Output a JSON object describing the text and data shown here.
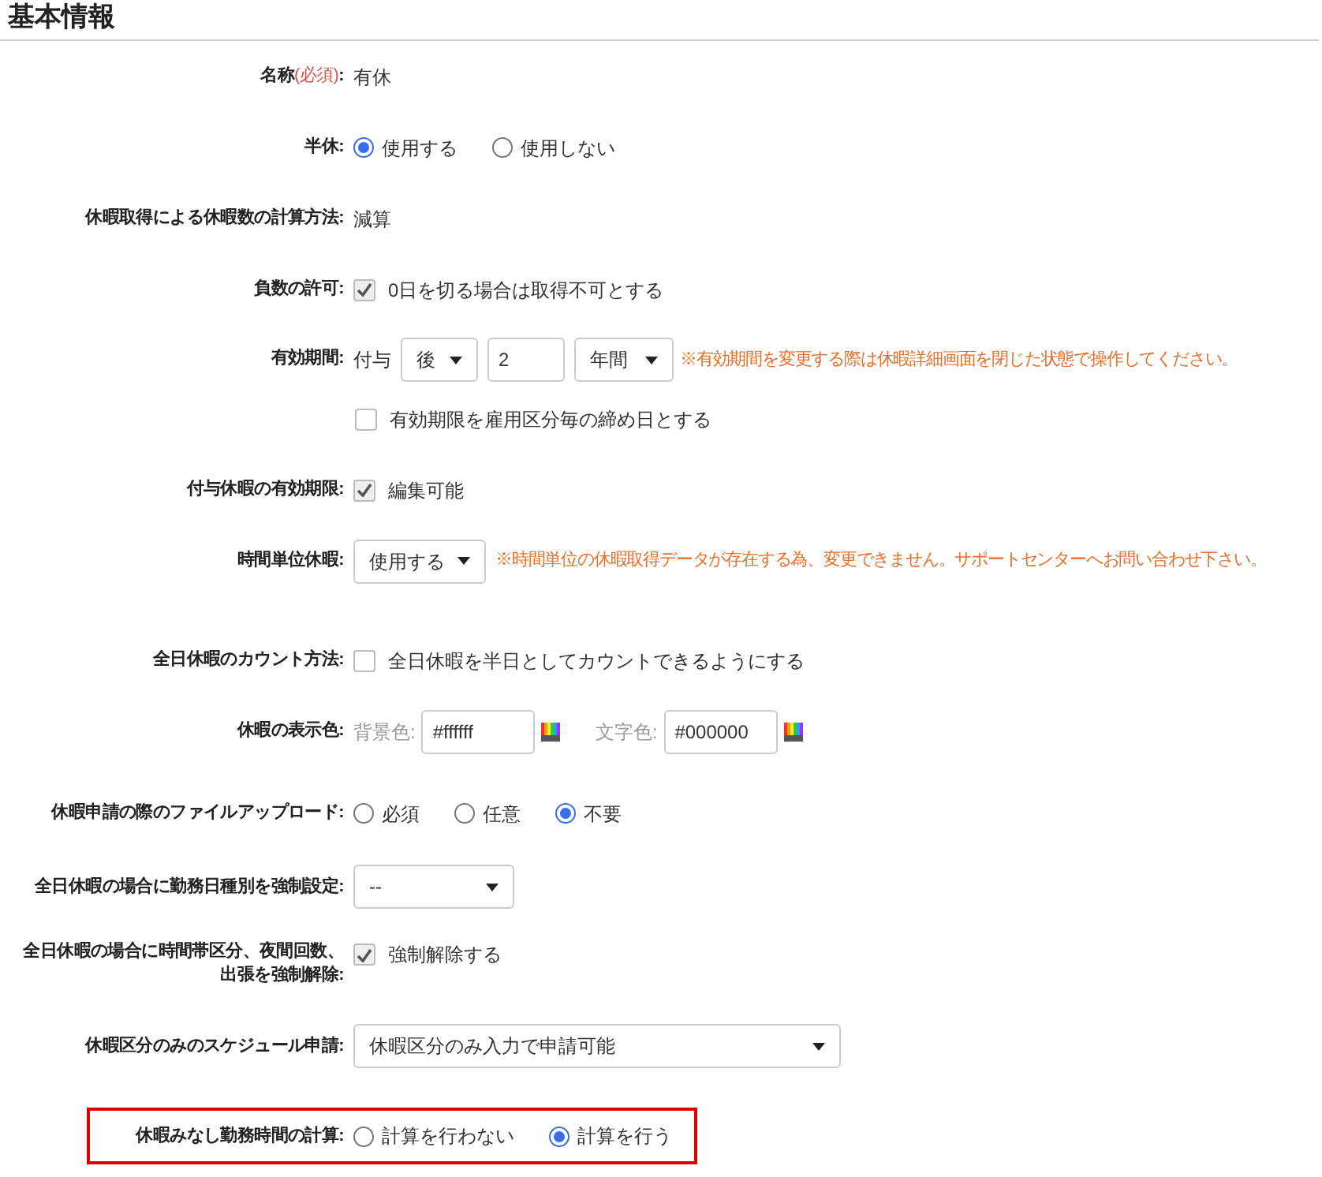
{
  "title": "基本情報",
  "rows": [
    {
      "kind": "text",
      "label": "名称",
      "required": "(必須)",
      "label_end": ":",
      "value": "有休"
    },
    {
      "kind": "radio",
      "label": "半休:",
      "options": [
        {
          "label": "使用する",
          "selected": true
        },
        {
          "label": "使用しない",
          "selected": false
        }
      ]
    },
    {
      "kind": "text",
      "label": "休暇取得による休暇数の計算方法:",
      "value": "減算"
    },
    {
      "kind": "checkbox",
      "label": "負数の許可:",
      "checked": true,
      "text": "0日を切る場合は取得不可とする"
    },
    {
      "kind": "period",
      "label": "有効期間:",
      "prefix": "付与",
      "direction": "後",
      "amount": "2",
      "unit": "年間",
      "note": "※有効期間を変更する際は休暇詳細画面を閉じた状態で操作してください。",
      "sub_checked": false,
      "sub_text": "有効期限を雇用区分毎の締め日とする"
    },
    {
      "kind": "checkbox",
      "label": "付与休暇の有効期限:",
      "checked": true,
      "text": "編集可能"
    },
    {
      "kind": "select",
      "label": "時間単位休暇:",
      "value": "使用する",
      "note": "※時間単位の休暇取得データが存在する為、変更できません。サポートセンターへお問い合わせ下さい。"
    },
    {
      "kind": "checkbox",
      "label": "全日休暇のカウント方法:",
      "checked": false,
      "text": "全日休暇を半日としてカウントできるようにする"
    },
    {
      "kind": "colors",
      "label": "休暇の表示色:",
      "fields": [
        {
          "caption": "背景色:",
          "value": "#ffffff"
        },
        {
          "caption": "文字色:",
          "value": "#000000"
        }
      ]
    },
    {
      "kind": "radio",
      "label": "休暇申請の際のファイルアップロード:",
      "options": [
        {
          "label": "必須",
          "selected": false
        },
        {
          "label": "任意",
          "selected": false
        },
        {
          "label": "不要",
          "selected": true
        }
      ]
    },
    {
      "kind": "select",
      "label": "全日休暇の場合に勤務日種別を強制設定:",
      "value": "--"
    },
    {
      "kind": "checkbox",
      "label": "全日休暇の場合に時間帯区分、夜間回数、出張を強制解除:",
      "checked": true,
      "text": "強制解除する"
    },
    {
      "kind": "select",
      "label": "休暇区分のみのスケジュール申請:",
      "value": "休暇区分のみ入力で申請可能"
    },
    {
      "kind": "radio",
      "label": "休暇みなし勤務時間の計算:",
      "highlighted": true,
      "options": [
        {
          "label": "計算を行わない",
          "selected": false
        },
        {
          "label": "計算を行う",
          "selected": true
        }
      ]
    }
  ]
}
